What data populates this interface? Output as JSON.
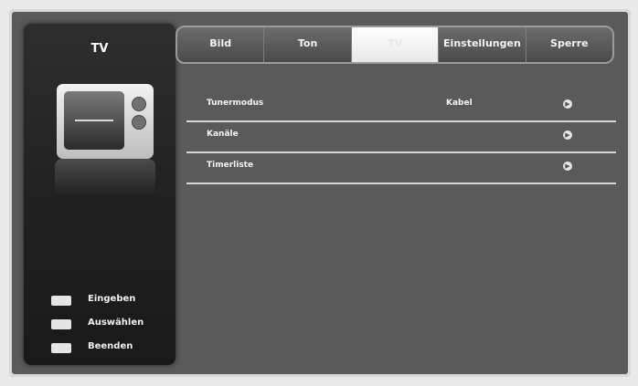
{
  "left_panel": {
    "title": "TV",
    "legend": [
      {
        "label": "Eingeben"
      },
      {
        "label": "Auswählen"
      },
      {
        "label": "Beenden"
      }
    ]
  },
  "tabs": [
    {
      "label": "Bild"
    },
    {
      "label": "Ton"
    },
    {
      "label": "TV",
      "active": true
    },
    {
      "label": "Einstellungen"
    },
    {
      "label": "Sperre"
    }
  ],
  "menu": [
    {
      "label": "Tunermodus",
      "value": "Kabel",
      "icon": "arrow-right-icon"
    },
    {
      "label": "Kanäle",
      "value": "",
      "icon": "arrow-right-icon"
    },
    {
      "label": "Timerliste",
      "value": "",
      "icon": "arrow-right-icon"
    }
  ]
}
